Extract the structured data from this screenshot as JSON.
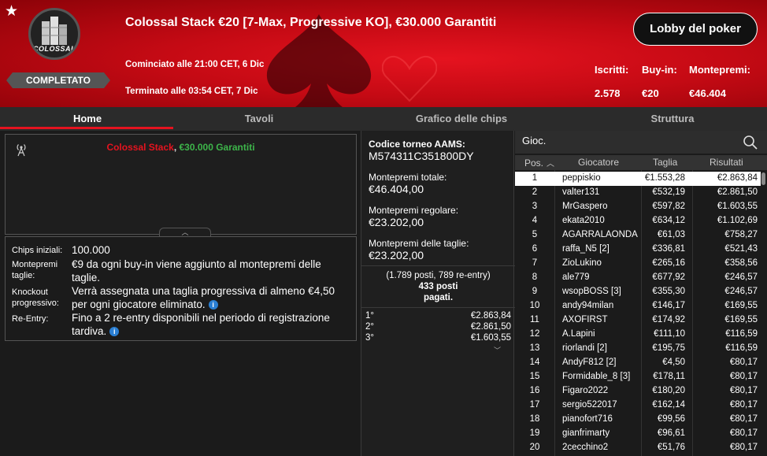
{
  "header": {
    "logo_text": "COLOSSAL",
    "status": "COMPLETATO",
    "title": "Colossal Stack €20 [7-Max, Progressive KO], €30.000 Garantiti",
    "started": "Cominciato alle 21:00 CET, 6 Dic",
    "ended": "Terminato alle 03:54 CET, 7 Dic",
    "lobby_button": "Lobby del poker",
    "stats": [
      {
        "label": "Iscritti:",
        "value": "2.578"
      },
      {
        "label": "Buy-in:",
        "value": "€20"
      },
      {
        "label": "Montepremi:",
        "value": "€46.404"
      }
    ],
    "colors": {
      "accent": "#e5131f",
      "green": "#3db54a"
    }
  },
  "tabs": [
    {
      "label": "Home",
      "active": true
    },
    {
      "label": "Tavoli",
      "active": false
    },
    {
      "label": "Grafico delle chips",
      "active": false
    },
    {
      "label": "Struttura",
      "active": false
    }
  ],
  "info": {
    "promo_red": "Colossal Stack",
    "promo_sep": ", ",
    "promo_green": "€30.000 Garantiti",
    "details": [
      {
        "label": "Chips iniziali:",
        "value": "100.000"
      },
      {
        "label": "Montepremi taglie:",
        "value": "€9 da ogni buy-in viene aggiunto al montepremi delle taglie."
      },
      {
        "label": "Knockout progressivo:",
        "value": "Verrà assegnata una taglia progressiva di almeno €4,50 per ogni giocatore eliminato."
      },
      {
        "label": "Re-Entry:",
        "value": "Fino a 2 re-entry disponibili nel periodo di registrazione tardiva."
      }
    ]
  },
  "summary": {
    "aams_label": "Codice torneo AAMS:",
    "aams_code": "M574311C351800DY",
    "total_label": "Montepremi totale:",
    "total_value": "€46.404,00",
    "regular_label": "Montepremi regolare:",
    "regular_value": "€23.202,00",
    "bounty_label": "Montepremi delle taglie:",
    "bounty_value": "€23.202,00",
    "seats_line1": "(1.789 posti, 789 re-entry)",
    "seats_line2": "433 posti",
    "seats_line3": "pagati.",
    "prizes": [
      {
        "place": "1°",
        "amount": "€2.863,84"
      },
      {
        "place": "2°",
        "amount": "€2.861,50"
      },
      {
        "place": "3°",
        "amount": "€1.603,55"
      }
    ]
  },
  "players": {
    "search_placeholder": "Gioc.",
    "headers": {
      "pos": "Pos.",
      "player": "Giocatore",
      "bounty": "Taglia",
      "result": "Risultati"
    },
    "rows": [
      {
        "pos": "1",
        "name": "peppiskio",
        "bounty": "€1.553,28",
        "result": "€2.863,84"
      },
      {
        "pos": "2",
        "name": "valter131",
        "bounty": "€532,19",
        "result": "€2.861,50"
      },
      {
        "pos": "3",
        "name": "MrGaspero",
        "bounty": "€597,82",
        "result": "€1.603,55"
      },
      {
        "pos": "4",
        "name": "ekata2010",
        "bounty": "€634,12",
        "result": "€1.102,69"
      },
      {
        "pos": "5",
        "name": "AGARRALAONDA",
        "bounty": "€61,03",
        "result": "€758,27"
      },
      {
        "pos": "6",
        "name": "raffa_N5 [2]",
        "bounty": "€336,81",
        "result": "€521,43"
      },
      {
        "pos": "7",
        "name": "ZioLukino",
        "bounty": "€265,16",
        "result": "€358,56"
      },
      {
        "pos": "8",
        "name": "ale779",
        "bounty": "€677,92",
        "result": "€246,57"
      },
      {
        "pos": "9",
        "name": "wsopBOSS [3]",
        "bounty": "€355,30",
        "result": "€246,57"
      },
      {
        "pos": "10",
        "name": "andy94milan",
        "bounty": "€146,17",
        "result": "€169,55"
      },
      {
        "pos": "11",
        "name": "AXOFIRST",
        "bounty": "€174,92",
        "result": "€169,55"
      },
      {
        "pos": "12",
        "name": "A.Lapini",
        "bounty": "€111,10",
        "result": "€116,59"
      },
      {
        "pos": "13",
        "name": "riorlandi [2]",
        "bounty": "€195,75",
        "result": "€116,59"
      },
      {
        "pos": "14",
        "name": "AndyF812 [2]",
        "bounty": "€4,50",
        "result": "€80,17"
      },
      {
        "pos": "15",
        "name": "Formidable_8 [3]",
        "bounty": "€178,11",
        "result": "€80,17"
      },
      {
        "pos": "16",
        "name": "Figaro2022",
        "bounty": "€180,20",
        "result": "€80,17"
      },
      {
        "pos": "17",
        "name": "sergio522017",
        "bounty": "€162,14",
        "result": "€80,17"
      },
      {
        "pos": "18",
        "name": "pianofort716",
        "bounty": "€99,56",
        "result": "€80,17"
      },
      {
        "pos": "19",
        "name": "gianfrimarty",
        "bounty": "€96,61",
        "result": "€80,17"
      },
      {
        "pos": "20",
        "name": "2cecchino2",
        "bounty": "€51,76",
        "result": "€80,17"
      }
    ]
  }
}
